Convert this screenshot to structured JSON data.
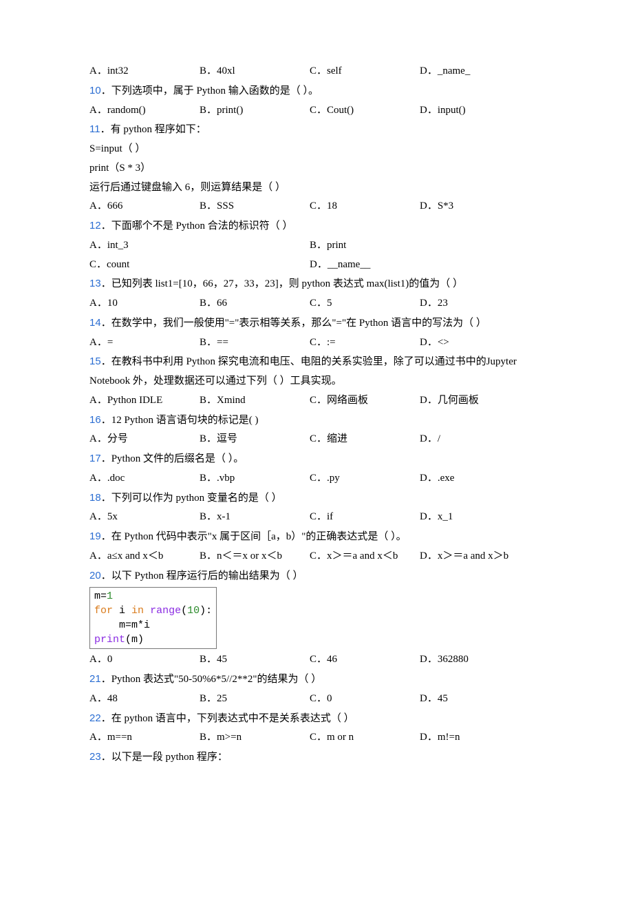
{
  "q9opts": {
    "a": "A．int32",
    "b": "B．40xl",
    "c": "C．self",
    "d": "D．_name_"
  },
  "q10": {
    "num": "10",
    "stem": "．下列选项中，属于 Python 输入函数的是（ ）。",
    "a": "A．random()",
    "b": "B．print()",
    "c": "C．Cout()",
    "d": "D．input()"
  },
  "q11": {
    "num": "11",
    "stem": "．有 python 程序如下：",
    "l1": "S=input（ ）",
    "l2": "print（S * 3）",
    "l3": "运行后通过键盘输入 6，则运算结果是（   ）",
    "a": "A．666",
    "b": "B．SSS",
    "c": "C．18",
    "d": "D．S*3"
  },
  "q12": {
    "num": "12",
    "stem": "．下面哪个不是 Python 合法的标识符（   ）",
    "a": "A．int_3",
    "b": "B．print",
    "c": "C．count",
    "d": "D．__name__"
  },
  "q13": {
    "num": "13",
    "stem": "．已知列表 list1=[10，66，27，33，23]，则 python 表达式 max(list1)的值为（   ）",
    "a": "A．10",
    "b": "B．66",
    "c": "C．5",
    "d": "D．23"
  },
  "q14": {
    "num": "14",
    "stem": "．在数学中，我们一般使用\"=\"表示相等关系，那么\"=\"在 Python 语言中的写法为（ ）",
    "a": "A．=",
    "b": "B．==",
    "c": "C．:=",
    "d": "D．<>"
  },
  "q15": {
    "num": "15",
    "stem": "．在教科书中利用 Python 探究电流和电压、电阻的关系实验里，除了可以通过书中的Jupyter Notebook 外，处理数据还可以通过下列（ ）工具实现。",
    "a": "A．Python IDLE",
    "b": "B．Xmind",
    "c": "C．网络画板",
    "d": "D．几何画板"
  },
  "q16": {
    "num": "16",
    "stem": "．12 Python 语言语句块的标记是(        )",
    "a": "A．分号",
    "b": "B．逗号",
    "c": "C．缩进",
    "d": "D．/"
  },
  "q17": {
    "num": "17",
    "stem": "．Python 文件的后缀名是（ ）。",
    "a": "A．.doc",
    "b": "B．.vbp",
    "c": "C．.py",
    "d": "D．.exe"
  },
  "q18": {
    "num": "18",
    "stem": "．下列可以作为 python 变量名的是（   ）",
    "a": "A．5x",
    "b": "B．x-1",
    "c": "C．if",
    "d": "D．x_1"
  },
  "q19": {
    "num": "19",
    "stem": "．在 Python 代码中表示\"x 属于区间［a，b）\"的正确表达式是（   ）。",
    "a": "A．a≤x and x＜b",
    "b": "B．n＜＝x or x＜b",
    "c": "C．x＞＝a and x＜b",
    "d": "D．x＞＝a and x＞b"
  },
  "q20": {
    "num": "20",
    "stem": "．以下 Python 程序运行后的输出结果为（   ）",
    "code": {
      "l1a": "m=",
      "l1b": "1",
      "l2a": "for",
      "l2b": " i ",
      "l2c": "in",
      "l2d": " ",
      "l2e": "range",
      "l2f": "(",
      "l2g": "10",
      "l2h": "):",
      "l3": "    m=m*i",
      "l4a": "print",
      "l4b": "(m)"
    },
    "a": "A．0",
    "b": "B．45",
    "c": "C．46",
    "d": "D．362880"
  },
  "q21": {
    "num": "21",
    "stem": "．Python 表达式\"50-50%6*5//2**2\"的结果为（ ）",
    "a": "A．48",
    "b": "B．25",
    "c": "C．0",
    "d": "D．45"
  },
  "q22": {
    "num": "22",
    "stem": "．在 python 语言中，下列表达式中不是关系表达式（   ）",
    "a": "A．m==n",
    "b": "B．m>=n",
    "c": "C．m or n",
    "d": "D．m!=n"
  },
  "q23": {
    "num": "23",
    "stem": "．以下是一段 python 程序："
  }
}
